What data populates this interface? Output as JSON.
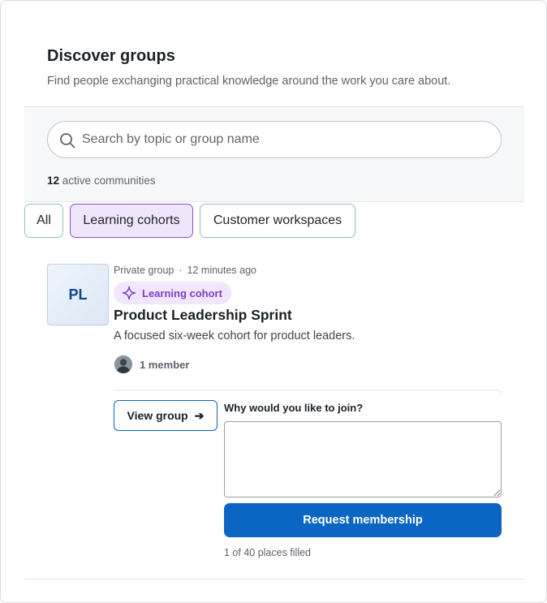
{
  "header": {
    "title": "Discover groups",
    "subtitle": "Find people exchanging practical knowledge around the work you care about."
  },
  "search": {
    "placeholder": "Search by topic or group name",
    "value": "",
    "count": "12",
    "count_suffix": "active communities"
  },
  "filters": [
    {
      "label": "All",
      "selected": false
    },
    {
      "label": "Learning cohorts",
      "selected": true
    },
    {
      "label": "Customer workspaces",
      "selected": false
    }
  ],
  "group": {
    "initials": "PL",
    "privacy": "Private group",
    "separator": "·",
    "time": "12 minutes ago",
    "badge": "Learning cohort",
    "name": "Product Leadership Sprint",
    "description": "A focused six-week cohort for product leaders.",
    "members": "1 member",
    "view_label": "View group",
    "view_arrow": "➔",
    "join_question": "Why would you like to join?",
    "join_value": "",
    "request_label": "Request membership",
    "places": "1 of 40 places filled"
  },
  "colors": {
    "accent": "#0a66c2",
    "badge_text": "#7c3fc4",
    "badge_bg": "#f1e7fc",
    "chip_selected_bg": "#f0e6fb",
    "chip_selected_border": "#8a4fd0",
    "chip_border": "#8fbfc4"
  },
  "icons": {
    "search": "search-icon",
    "badge": "sparkle-icon",
    "member": "member-avatar",
    "arrow": "arrow-right-icon"
  }
}
